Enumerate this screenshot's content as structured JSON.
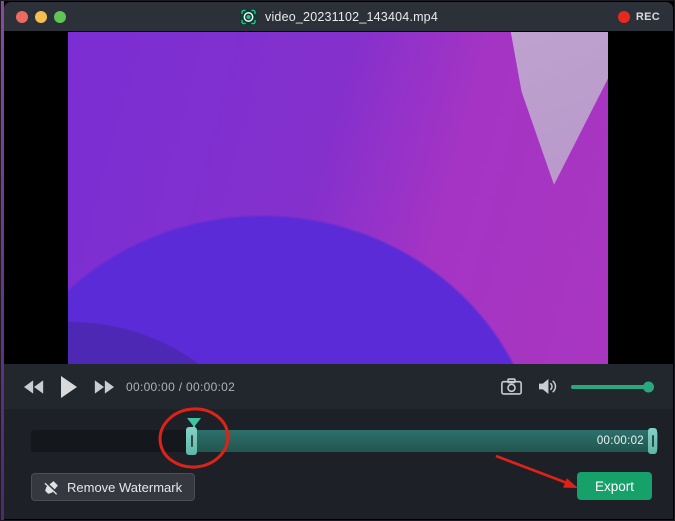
{
  "window": {
    "title": "video_20231102_143404.mp4",
    "rec_label": "REC",
    "app_icon": "screen-recorder-viewfinder-icon",
    "traffic_lights": [
      "close",
      "minimize",
      "zoom"
    ],
    "titlebar_color": "#2c3039"
  },
  "player": {
    "description": "purple abstract wallpaper video frame, letterboxed on black"
  },
  "controls": {
    "time_display": "00:00:00 / 00:00:02",
    "icons": [
      "rewind-icon",
      "play-icon",
      "fast-forward-icon",
      "snapshot-icon",
      "volume-icon"
    ],
    "volume_level": "full",
    "accent_color": "#2aa87d"
  },
  "timeline": {
    "end_time_label": "00:00:02",
    "selected_color": "#2a6b66",
    "handle_color": "#6fc7ba"
  },
  "footer": {
    "remove_watermark_label": "Remove Watermark",
    "export_label": "Export",
    "export_color": "#16a16b"
  },
  "annotations": {
    "color": "#dd2318",
    "circle_target": "trim-start-handle",
    "arrow_target": "export-button"
  }
}
